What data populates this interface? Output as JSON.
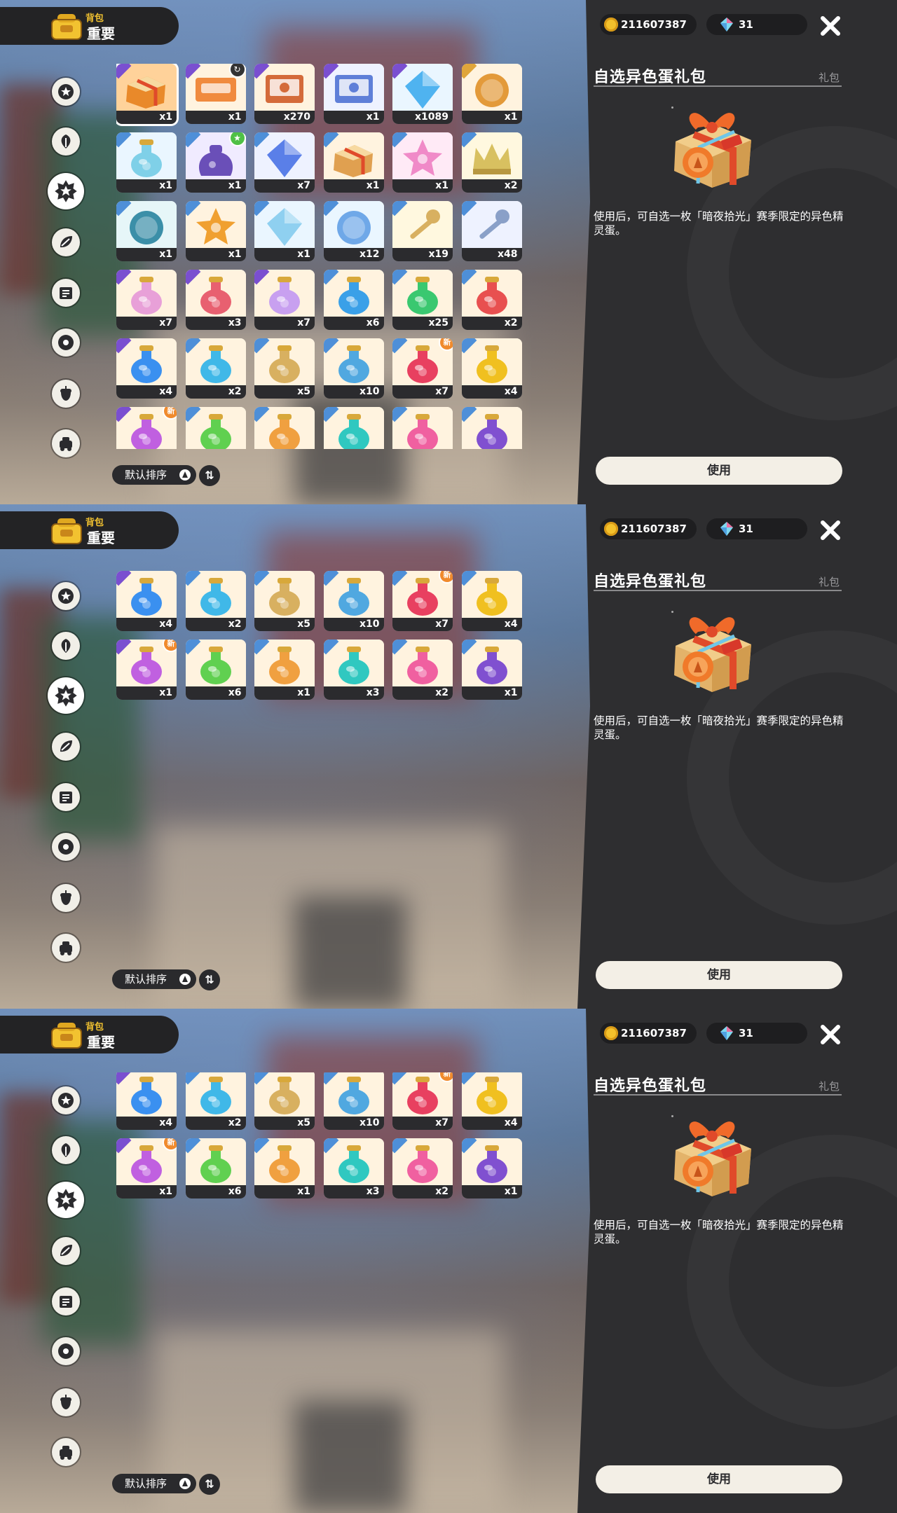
{
  "header": {
    "bag_label": "背包",
    "category_label": "重要"
  },
  "currency": {
    "gold": "211607387",
    "gems": "31"
  },
  "detail": {
    "title": "自选异色蛋礼包",
    "tag": "礼包",
    "description": "使用后，可自选一枚「暗夜拾光」赛季限定的异色精灵蛋。",
    "use_label": "使用"
  },
  "sort": {
    "label": "默认排序",
    "toggle": "⇅"
  },
  "categories": [
    "star",
    "leaf",
    "badge",
    "leaves",
    "scroll",
    "ball",
    "acorn",
    "cart"
  ],
  "colors": {
    "accent": "#f2c230",
    "side_panel": "#2e2e30",
    "new_badge": "#f08a2c",
    "count_bar": "#2b2b2e"
  },
  "items": [
    {
      "count": "x1",
      "icon": "gift-box-icon",
      "hue": "#e9892a",
      "bg": "#ffd29a",
      "rarity": "#7a4fd0",
      "shape": "box"
    },
    {
      "count": "x1",
      "icon": "ticket-icon",
      "hue": "#f08a3e",
      "bg": "#fff3df",
      "rarity": "#7a4fd0",
      "shape": "ticket",
      "mark": "swirl"
    },
    {
      "count": "x270",
      "icon": "photo-card-icon",
      "hue": "#d46b3a",
      "bg": "#fff3df",
      "rarity": "#7a4fd0",
      "shape": "card"
    },
    {
      "count": "x1",
      "icon": "envelope-icon",
      "hue": "#5f7fd8",
      "bg": "#eef2ff",
      "rarity": "#7a4fd0",
      "shape": "card"
    },
    {
      "count": "x1089",
      "icon": "crystal-icon",
      "hue": "#4fb3f0",
      "bg": "#eaf6ff",
      "rarity": "#7a4fd0",
      "shape": "gem"
    },
    {
      "count": "x1",
      "icon": "bronze-medal-icon",
      "hue": "#e39a3a",
      "bg": "#fff3df",
      "rarity": "#e0a53a",
      "shape": "coin"
    },
    {
      "count": "x1",
      "icon": "bottle-icon",
      "hue": "#7fd0e8",
      "bg": "#eaf6ff",
      "rarity": "#4e8fd8",
      "shape": "flask"
    },
    {
      "count": "x1",
      "icon": "pouch-icon",
      "hue": "#6a4fb8",
      "bg": "#f0ebff",
      "rarity": "#4e8fd8",
      "shape": "pouch",
      "mark": "star"
    },
    {
      "count": "x7",
      "icon": "blue-crystal-icon",
      "hue": "#5a7fe8",
      "bg": "#eef2ff",
      "rarity": "#4e8fd8",
      "shape": "gem"
    },
    {
      "count": "x1",
      "icon": "treasure-box-icon",
      "hue": "#e0a050",
      "bg": "#fff3df",
      "rarity": "#4e8fd8",
      "shape": "box"
    },
    {
      "count": "x1",
      "icon": "star-gem-icon",
      "hue": "#f08ac8",
      "bg": "#ffeaf6",
      "rarity": "#4e8fd8",
      "shape": "star"
    },
    {
      "count": "x2",
      "icon": "crown-icon",
      "hue": "#d8c060",
      "bg": "#fff8df",
      "rarity": "#4e8fd8",
      "shape": "crown"
    },
    {
      "count": "x1",
      "icon": "shell-icon",
      "hue": "#3b8fa8",
      "bg": "#e6f6f8",
      "rarity": "#4e8fd8",
      "shape": "coin"
    },
    {
      "count": "x1",
      "icon": "flame-emblem-icon",
      "hue": "#f0a030",
      "bg": "#fff3df",
      "rarity": "#4e8fd8",
      "shape": "star"
    },
    {
      "count": "x1",
      "icon": "mirror-icon",
      "hue": "#8fd0f0",
      "bg": "#eaf6ff",
      "rarity": "#4e8fd8",
      "shape": "gem"
    },
    {
      "count": "x12",
      "icon": "blue-stone-icon",
      "hue": "#6fa8e8",
      "bg": "#eaf6ff",
      "rarity": "#4e8fd8",
      "shape": "coin"
    },
    {
      "count": "x19",
      "icon": "key-icon",
      "hue": "#d8b060",
      "bg": "#fff8df",
      "rarity": "#4e8fd8",
      "shape": "key"
    },
    {
      "count": "x48",
      "icon": "wand-icon",
      "hue": "#8aa0c8",
      "bg": "#eef2ff",
      "rarity": "#4e8fd8",
      "shape": "key"
    },
    {
      "count": "x7",
      "icon": "rainbow-potion-icon",
      "hue": "#e8a0d8",
      "bg": "#fff3df",
      "rarity": "#7a4fd0",
      "shape": "flask"
    },
    {
      "count": "x3",
      "icon": "pink-potion-icon",
      "hue": "#e86070",
      "bg": "#fff3df",
      "rarity": "#7a4fd0",
      "shape": "flask"
    },
    {
      "count": "x7",
      "icon": "prism-potion-icon",
      "hue": "#c8a0f0",
      "bg": "#fff3df",
      "rarity": "#7a4fd0",
      "shape": "flask"
    },
    {
      "count": "x6",
      "icon": "blue-potion-icon",
      "hue": "#3aa0e8",
      "bg": "#fff3df",
      "rarity": "#4e8fd8",
      "shape": "flask"
    },
    {
      "count": "x25",
      "icon": "green-potion-icon",
      "hue": "#3ac870",
      "bg": "#fff3df",
      "rarity": "#4e8fd8",
      "shape": "flask"
    },
    {
      "count": "x2",
      "icon": "red-potion-icon",
      "hue": "#e85050",
      "bg": "#fff3df",
      "rarity": "#4e8fd8",
      "shape": "flask"
    },
    {
      "count": "x4",
      "icon": "water-potion-icon",
      "hue": "#3a90f0",
      "bg": "#fff3df",
      "rarity": "#7a4fd0",
      "shape": "flask"
    },
    {
      "count": "x2",
      "icon": "ice-potion-icon",
      "hue": "#40b8e8",
      "bg": "#fff3df",
      "rarity": "#4e8fd8",
      "shape": "flask"
    },
    {
      "count": "x5",
      "icon": "sand-potion-icon",
      "hue": "#d8b060",
      "bg": "#fff3df",
      "rarity": "#4e8fd8",
      "shape": "flask"
    },
    {
      "count": "x10",
      "icon": "wind-potion-icon",
      "hue": "#50a8e0",
      "bg": "#fff3df",
      "rarity": "#4e8fd8",
      "shape": "flask"
    },
    {
      "count": "x7",
      "icon": "fire-potion-icon",
      "hue": "#e84060",
      "bg": "#fff3df",
      "rarity": "#4e8fd8",
      "shape": "flask",
      "mark": "new"
    },
    {
      "count": "x4",
      "icon": "light-potion-icon",
      "hue": "#f0c020",
      "bg": "#fff3df",
      "rarity": "#4e8fd8",
      "shape": "flask"
    },
    {
      "count": "x1",
      "icon": "violet-potion-icon",
      "hue": "#c060e0",
      "bg": "#fff3df",
      "rarity": "#7a4fd0",
      "shape": "flask",
      "mark": "new"
    },
    {
      "count": "x6",
      "icon": "grass-potion-icon",
      "hue": "#60d050",
      "bg": "#fff3df",
      "rarity": "#4e8fd8",
      "shape": "flask"
    },
    {
      "count": "x1",
      "icon": "amber-potion-icon",
      "hue": "#f0a040",
      "bg": "#fff3df",
      "rarity": "#4e8fd8",
      "shape": "flask"
    },
    {
      "count": "x3",
      "icon": "teal-potion-icon",
      "hue": "#30c8c0",
      "bg": "#fff3df",
      "rarity": "#4e8fd8",
      "shape": "flask"
    },
    {
      "count": "x2",
      "icon": "heart-potion-icon",
      "hue": "#f060a0",
      "bg": "#fff3df",
      "rarity": "#4e8fd8",
      "shape": "flask"
    },
    {
      "count": "x1",
      "icon": "ghost-potion-icon",
      "hue": "#8050d0",
      "bg": "#fff3df",
      "rarity": "#4e8fd8",
      "shape": "flask"
    }
  ]
}
